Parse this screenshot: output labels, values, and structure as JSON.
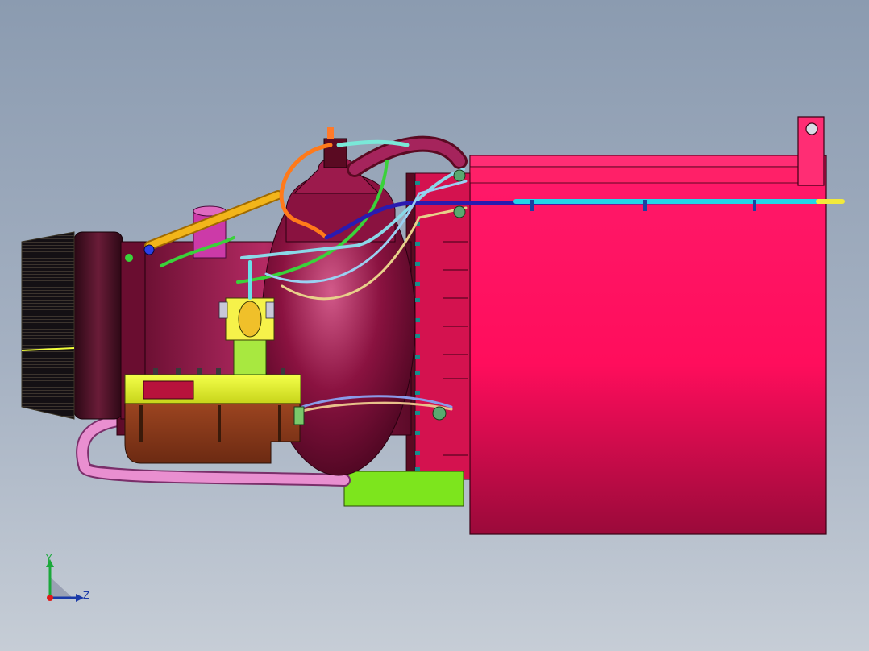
{
  "viewport": {
    "background_top": "#8b9bb0",
    "background_bottom": "#c6cdd6"
  },
  "model": {
    "housing_color": "#ff1a66",
    "body_color": "#8a0f38",
    "flange_color": "#e9f52a",
    "pump_color": "#8c3a1c",
    "base_plate_color": "#7de51d",
    "pipe_color": "#e98fd0"
  },
  "triad": {
    "y_label": "Y",
    "z_label": "Z",
    "y_color": "#1aa83a",
    "z_color": "#1a3aa8",
    "x_color": "#e01a1a"
  }
}
